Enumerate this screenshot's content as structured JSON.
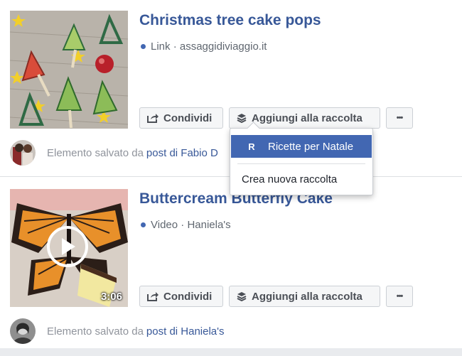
{
  "colors": {
    "link": "#385898",
    "accent": "#4267b2",
    "muted": "#90949c"
  },
  "items": [
    {
      "title": "Christmas tree cake pops",
      "type": "Link",
      "source": "assaggidiviaggio.it",
      "share_label": "Condividi",
      "add_label": "Aggiungi alla raccolta",
      "more_label": "•••",
      "saved_prefix": "Elemento salvato da",
      "saved_link": "post di Fabio D"
    },
    {
      "title": "Buttercream Butterfly Cake",
      "type": "Video",
      "source": "Haniela's",
      "duration": "3:06",
      "share_label": "Condividi",
      "add_label": "Aggiungi alla raccolta",
      "more_label": "•••",
      "saved_prefix": "Elemento salvato da",
      "saved_link": "post di Haniela's"
    }
  ],
  "dropdown": {
    "selected_badge": "R",
    "selected_label": "Ricette per Natale",
    "new_collection_label": "Crea nuova raccolta"
  }
}
